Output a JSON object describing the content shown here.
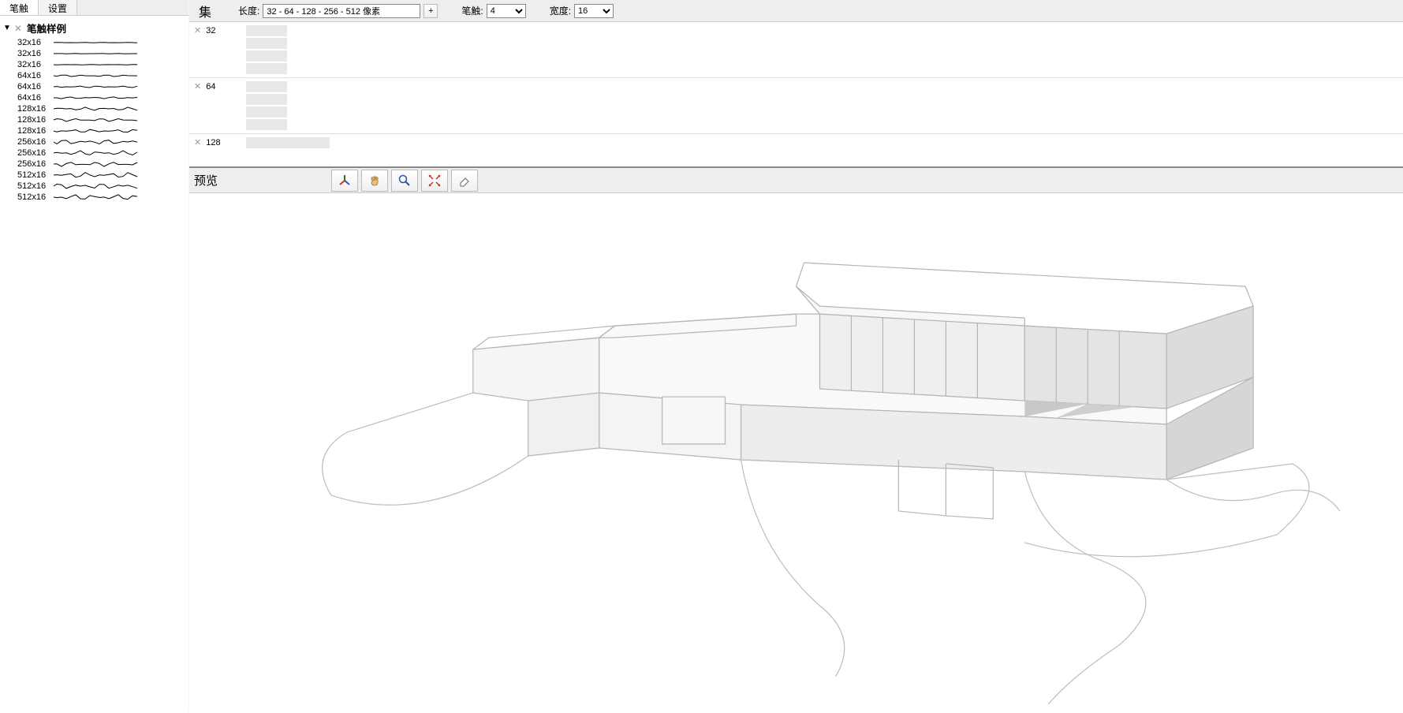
{
  "sidebar": {
    "tabs": [
      {
        "label": "笔触",
        "active": true
      },
      {
        "label": "设置",
        "active": false
      }
    ],
    "tree_header": "笔触样例",
    "items": [
      {
        "label": "32x16",
        "seed": 1
      },
      {
        "label": "32x16",
        "seed": 2
      },
      {
        "label": "32x16",
        "seed": 3
      },
      {
        "label": "64x16",
        "seed": 4
      },
      {
        "label": "64x16",
        "seed": 5
      },
      {
        "label": "64x16",
        "seed": 6
      },
      {
        "label": "128x16",
        "seed": 7
      },
      {
        "label": "128x16",
        "seed": 8
      },
      {
        "label": "128x16",
        "seed": 9
      },
      {
        "label": "256x16",
        "seed": 10
      },
      {
        "label": "256x16",
        "seed": 11
      },
      {
        "label": "256x16",
        "seed": 12
      },
      {
        "label": "512x16",
        "seed": 13
      },
      {
        "label": "512x16",
        "seed": 14
      },
      {
        "label": "512x16",
        "seed": 15
      }
    ]
  },
  "topbar": {
    "set_title": "集",
    "length_label": "长度:",
    "length_value": "32 - 64 - 128 - 256 - 512 像素",
    "plus": "+",
    "stroke_label": "笔触:",
    "stroke_value": "4",
    "width_label": "宽度:",
    "width_value": "16"
  },
  "sets": [
    {
      "label": "32",
      "thumbs": 4,
      "wide": false
    },
    {
      "label": "64",
      "thumbs": 4,
      "wide": false
    },
    {
      "label": "128",
      "thumbs": 1,
      "wide": true
    }
  ],
  "preview": {
    "title": "预览",
    "tools": [
      {
        "name": "axis",
        "label": "axis-icon"
      },
      {
        "name": "hand",
        "label": "hand-icon"
      },
      {
        "name": "zoom",
        "label": "magnifier-icon"
      },
      {
        "name": "extents",
        "label": "extents-icon"
      },
      {
        "name": "erase",
        "label": "eraser-icon"
      }
    ]
  }
}
